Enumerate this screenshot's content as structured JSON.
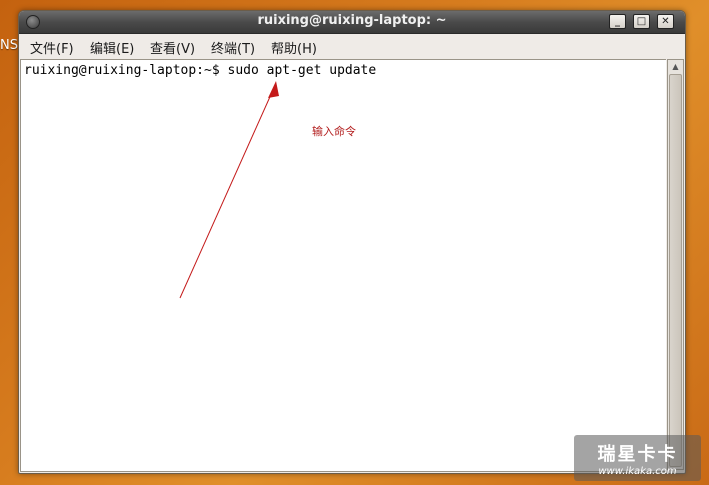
{
  "desktop": {
    "edge_text": "NS"
  },
  "window": {
    "title": "ruixing@ruixing-laptop: ~",
    "controls": {
      "minimize": "_",
      "maximize": "□",
      "close": "✕"
    }
  },
  "menubar": {
    "items": [
      {
        "label": "文件(F)"
      },
      {
        "label": "编辑(E)"
      },
      {
        "label": "查看(V)"
      },
      {
        "label": "终端(T)"
      },
      {
        "label": "帮助(H)"
      }
    ]
  },
  "terminal": {
    "prompt_line": "ruixing@ruixing-laptop:~$ sudo apt-get update"
  },
  "annotation": {
    "text": "输入命令",
    "color": "#b21c1c"
  },
  "watermark": {
    "brand": "瑞星卡卡",
    "url": "www.ikaka.com"
  },
  "colors": {
    "desktop": "#d77d1f",
    "titlebar": "#4a4a4a",
    "window_bg": "#efebe7",
    "terminal_bg": "#ffffff"
  }
}
